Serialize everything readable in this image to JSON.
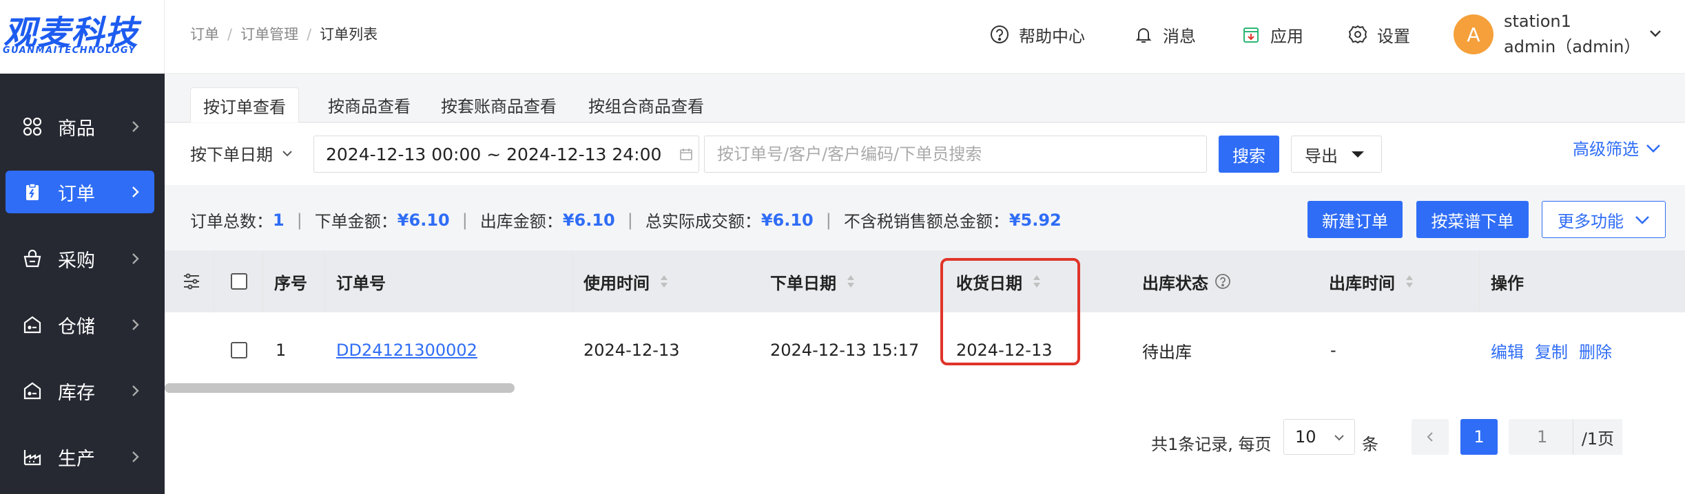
{
  "logo": {
    "main": "观麦科技",
    "sub": "GUANMAITECHNOLOGY"
  },
  "sidebar": {
    "items": [
      {
        "label": "商品",
        "icon": "grid-icon",
        "active": false
      },
      {
        "label": "订单",
        "icon": "order-clipboard-icon",
        "active": true
      },
      {
        "label": "采购",
        "icon": "basket-icon",
        "active": false
      },
      {
        "label": "仓储",
        "icon": "warehouse-icon",
        "active": false
      },
      {
        "label": "库存",
        "icon": "inventory-icon",
        "active": false
      },
      {
        "label": "生产",
        "icon": "factory-icon",
        "active": false
      }
    ]
  },
  "header": {
    "breadcrumb": [
      "订单",
      "订单管理",
      "订单列表"
    ],
    "help": "帮助中心",
    "messages": "消息",
    "apps": "应用",
    "settings": "设置",
    "avatar_letter": "A",
    "user_name": "station1",
    "user_role": "admin（admin）"
  },
  "tabs": [
    "按订单查看",
    "按商品查看",
    "按套账商品查看",
    "按组合商品查看"
  ],
  "filter": {
    "date_type": "按下单日期",
    "date_range": "2024-12-13 00:00 ~ 2024-12-13 24:00",
    "search_placeholder": "按订单号/客户/客户编码/下单员搜索",
    "search_button": "搜索",
    "export_button": "导出",
    "advanced": "高级筛选"
  },
  "summary": {
    "total_orders_label": "订单总数：",
    "total_orders": "1",
    "order_amount_label": "下单金额：",
    "order_amount": "¥6.10",
    "out_amount_label": "出库金额：",
    "out_amount": "¥6.10",
    "actual_amount_label": "总实际成交额：",
    "actual_amount": "¥6.10",
    "ex_tax_label": "不含税销售额总金额：",
    "ex_tax": "¥5.92",
    "new_order": "新建订单",
    "menu_order": "按菜谱下单",
    "more": "更多功能"
  },
  "table": {
    "headers": {
      "seq": "序号",
      "order_no": "订单号",
      "use_time": "使用时间",
      "order_date": "下单日期",
      "receive_date": "收货日期",
      "out_status": "出库状态",
      "out_time": "出库时间",
      "ops": "操作"
    },
    "rows": [
      {
        "seq": "1",
        "order_no": "DD24121300002",
        "use_time": "2024-12-13",
        "order_date": "2024-12-13 15:17",
        "receive_date": "2024-12-13",
        "out_status": "待出库",
        "out_time": "-",
        "edit": "编辑",
        "copy": "复制",
        "delete": "删除"
      }
    ]
  },
  "pager": {
    "total_text": "共1条记录, 每页",
    "page_size": "10",
    "unit": "条",
    "current": "1",
    "jump_value": "1",
    "total_pages": "/1页"
  },
  "colors": {
    "primary": "#2f6df6",
    "sidebar": "#262932",
    "highlight": "#e0342a",
    "avatar": "#f5a03a"
  }
}
